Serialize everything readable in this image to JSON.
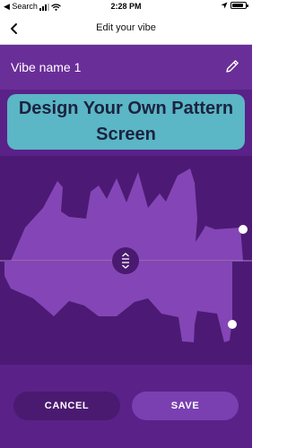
{
  "status_bar": {
    "back_app": "◀ Search",
    "time": "2:28 PM"
  },
  "nav": {
    "title": "Edit your vibe",
    "back_icon": "chevron-left-icon"
  },
  "vibe": {
    "name": "Vibe name 1",
    "edit_icon": "pencil-icon"
  },
  "overlay": {
    "line1": "Design Your Own Pattern",
    "line2": "Screen"
  },
  "editor": {
    "center_handle_icon": "split-arrows-icon"
  },
  "footer": {
    "cancel_label": "CANCEL",
    "save_label": "SAVE"
  },
  "colors": {
    "background": "#5a2188",
    "header": "#6a2e99",
    "editor_bg": "#4c1a74",
    "pattern_fill": "#8446b6",
    "overlay_bg": "#5bb6c6",
    "overlay_text": "#1c2340"
  }
}
